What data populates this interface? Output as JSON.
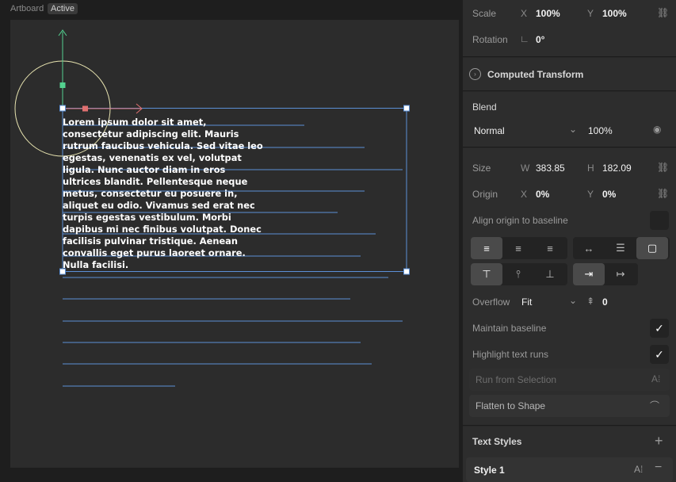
{
  "canvas": {
    "artboard_label": "Artboard",
    "active_badge": "Active",
    "text_lines": [
      "Lorem ipsum dolor sit amet,",
      "consectetur adipiscing elit. Mauris",
      "rutrum faucibus vehicula. Sed vitae leo",
      "egestas, venenatis ex vel, volutpat",
      "ligula. Nunc auctor diam in eros",
      "ultrices blandit. Pellentesque neque",
      "metus, consectetur eu posuere in,",
      "aliquet eu odio. Vivamus sed erat nec",
      "turpis egestas vestibulum. Morbi",
      "dapibus mi nec finibus volutpat. Donec",
      "facilisis pulvinar tristique. Aenean",
      "convallis eget purus laoreet ornare.",
      "Nulla facilisi."
    ]
  },
  "panel": {
    "scale": {
      "label": "Scale",
      "x_axis": "X",
      "x_value": "100%",
      "y_axis": "Y",
      "y_value": "100%"
    },
    "rotation": {
      "label": "Rotation",
      "value": "0°"
    },
    "computed_transform": {
      "label": "Computed Transform"
    },
    "blend": {
      "title": "Blend",
      "mode": "Normal",
      "opacity": "100%"
    },
    "size": {
      "label": "Size",
      "w_axis": "W",
      "w_value": "383.85",
      "h_axis": "H",
      "h_value": "182.09"
    },
    "origin": {
      "label": "Origin",
      "x_axis": "X",
      "x_value": "0%",
      "y_axis": "Y",
      "y_value": "0%"
    },
    "align_origin": {
      "label": "Align origin to baseline"
    },
    "overflow": {
      "label": "Overflow",
      "value": "Fit",
      "count": "0"
    },
    "maintain_baseline": {
      "label": "Maintain baseline"
    },
    "highlight_runs": {
      "label": "Highlight text runs"
    },
    "run_from_selection": {
      "label": "Run from Selection"
    },
    "flatten": {
      "label": "Flatten to Shape"
    },
    "text_styles": {
      "title": "Text Styles",
      "style_name": "Style 1"
    }
  },
  "colors": {
    "accent_blue": "#5b8fd6",
    "axis_green": "#53d18f",
    "axis_red": "#e07070",
    "circle": "#e8e4b0"
  }
}
